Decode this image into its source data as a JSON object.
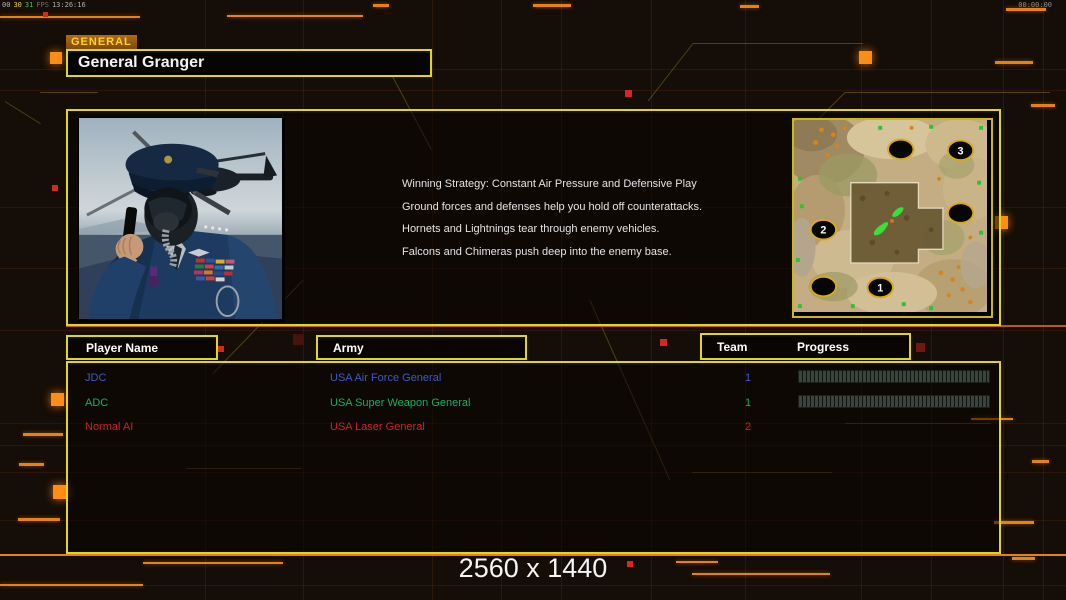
{
  "overlay": {
    "stats": [
      {
        "text": "00",
        "color": "#b8b8b8"
      },
      {
        "text": "30",
        "color": "#e8d020"
      },
      {
        "text": "31",
        "color": "#48c048"
      },
      {
        "text": "FPS",
        "color": "#6e6e6e"
      },
      {
        "text": "13:26:16",
        "color": "#aeaeae"
      }
    ],
    "clock": "00:00:00"
  },
  "header": {
    "tab_label": "GENERAL",
    "general_name": "General Granger"
  },
  "briefing": {
    "lines": [
      "Winning Strategy: Constant Air Pressure and Defensive Play",
      "Ground forces and defenses help you hold off counterattacks.",
      "Hornets and Lightnings tear through enemy vehicles.",
      "Falcons and Chimeras push deep into the enemy base."
    ]
  },
  "minimap": {
    "markers": [
      {
        "label": "1"
      },
      {
        "label": "2"
      },
      {
        "label": "3"
      }
    ]
  },
  "table": {
    "player_header": "Player Name",
    "army_header": "Army",
    "team_header": "Team",
    "progress_header": "Progress"
  },
  "players": {
    "rows": [
      {
        "name": "JDC",
        "army": "USA Air Force General",
        "team": "1",
        "color": "#3f58c8"
      },
      {
        "name": "ADC",
        "army": "USA Super Weapon General",
        "team": "1",
        "color": "#12b058"
      },
      {
        "name": "Normal AI",
        "army": "USA Laser General",
        "team": "2",
        "color": "#cc241a"
      }
    ]
  },
  "footer": {
    "resolution": "2560 x 1440"
  },
  "colors": {
    "accent_yellow": "#e0d61e",
    "accent_orange": "#e8820f",
    "alert_red": "#d8281c"
  }
}
